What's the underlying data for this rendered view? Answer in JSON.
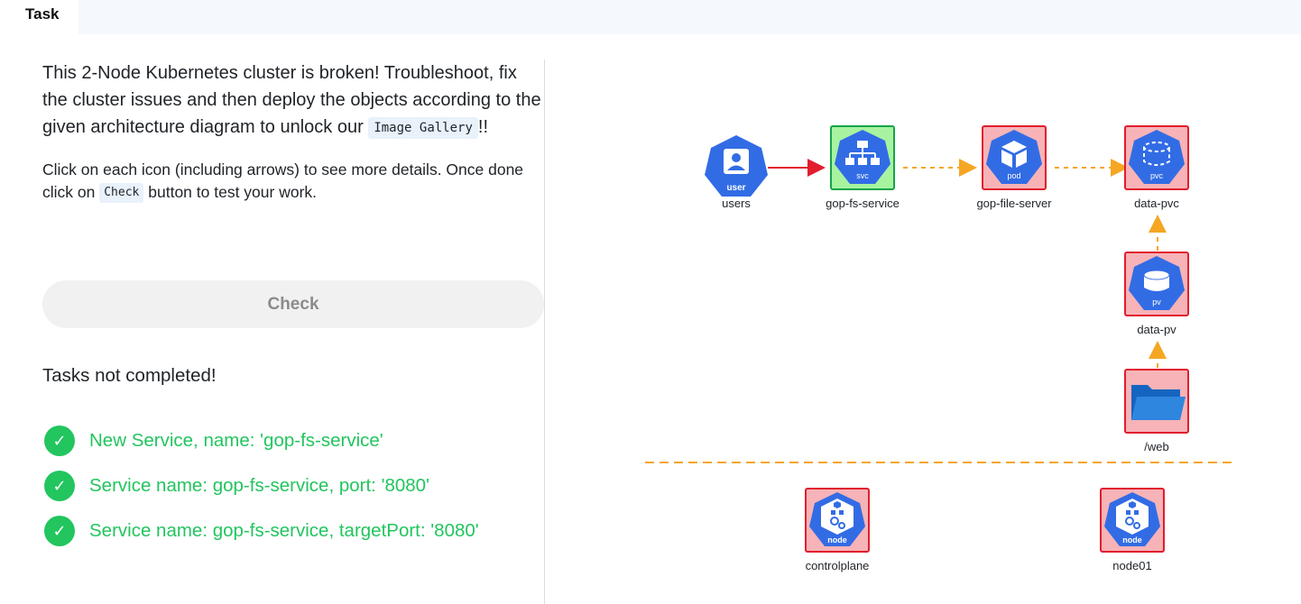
{
  "tab": {
    "label": "Task"
  },
  "intro": {
    "text": "This 2-Node Kubernetes cluster is broken! Troubleshoot, fix the cluster issues and then deploy the objects according to the given architecture diagram to unlock our",
    "code": "Image Gallery",
    "suffix": "!!"
  },
  "instructions": {
    "before": "Click on each icon (including arrows) to see more details. Once done click on",
    "code": "Check",
    "after": "button to test your work."
  },
  "check_button": {
    "label": "Check"
  },
  "status_text": "Tasks not completed!",
  "tasks": [
    {
      "label": "New Service, name: 'gop-fs-service'",
      "done": true
    },
    {
      "label": "Service name: gop-fs-service, port: '8080'",
      "done": true
    },
    {
      "label": "Service name: gop-fs-service, targetPort: '8080'",
      "done": true
    }
  ],
  "diagram": {
    "nodes": {
      "users": {
        "label": "users",
        "badge": "user"
      },
      "service": {
        "label": "gop-fs-service",
        "badge": "svc",
        "state": "ok"
      },
      "pod": {
        "label": "gop-file-server",
        "badge": "pod",
        "state": "error"
      },
      "pvc": {
        "label": "data-pvc",
        "badge": "pvc",
        "state": "error"
      },
      "pv": {
        "label": "data-pv",
        "badge": "pv",
        "state": "error"
      },
      "web": {
        "label": "/web",
        "state": "error"
      },
      "controlplane": {
        "label": "controlplane",
        "badge": "node",
        "state": "error"
      },
      "node01": {
        "label": "node01",
        "badge": "node",
        "state": "error"
      }
    },
    "colors": {
      "k8s_blue": "#326ce5",
      "error_border": "#e11d2e",
      "error_fill": "#f7b3b7",
      "ok_border": "#16a34a",
      "ok_fill": "#a7f3a0",
      "arrow_red": "#e11d2e",
      "arrow_orange": "#f5a623",
      "folder_blue": "#1565c0"
    }
  }
}
